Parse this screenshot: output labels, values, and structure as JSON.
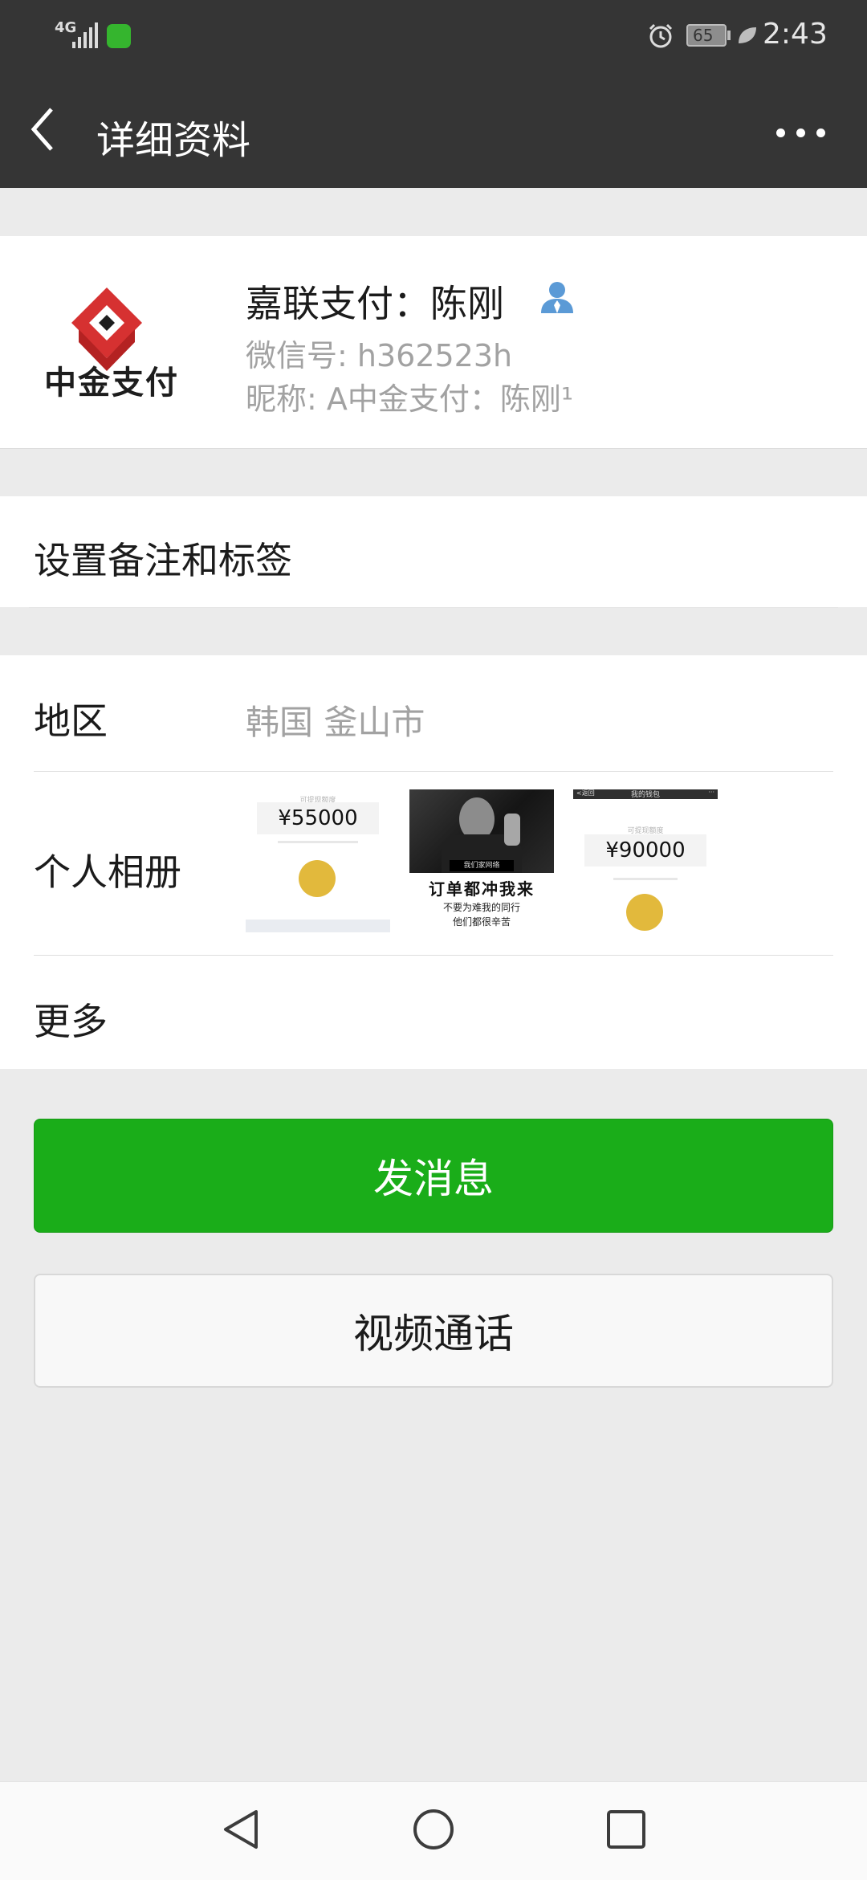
{
  "status_bar": {
    "network": "4G",
    "battery": "65",
    "time": "2:43",
    "icons": [
      "signal-icon",
      "app-notification-icon",
      "alarm-icon",
      "battery-icon",
      "leaf-icon"
    ]
  },
  "header": {
    "title": "详细资料",
    "back_icon": "back-chevron-icon",
    "more_icon": "more-dots-icon"
  },
  "profile": {
    "name": "嘉联支付：陈刚",
    "wechat_id": "微信号: h362523h",
    "nickname": "昵称: A中金支付：陈刚¹",
    "avatar_text": "中金支付",
    "contact_icon": "contact-person-icon"
  },
  "remark": {
    "label": "设置备注和标签"
  },
  "region": {
    "label": "地区",
    "value": "韩国  釜山市"
  },
  "album": {
    "label": "个人相册",
    "photos": [
      {
        "amount": "¥55000",
        "caption": "可提现额度"
      },
      {
        "title": "订单都冲我来",
        "subtitle1": "不要为难我的同行",
        "subtitle2": "他们都很辛苦",
        "badge": "我们家网络"
      },
      {
        "amount": "¥90000",
        "caption": "可提现额度",
        "top_left": "<返回",
        "top_title": "我的钱包",
        "top_right": "···"
      }
    ]
  },
  "more": {
    "label": "更多"
  },
  "actions": {
    "send_message": "发消息",
    "video_call": "视频通话"
  },
  "colors": {
    "header_bg": "#353535",
    "primary_green": "#1aad19",
    "secondary_text": "#a2a2a2",
    "page_bg": "#ebebeb",
    "contact_icon_blue": "#5b9ad6"
  },
  "nav_bar": {
    "buttons": [
      "nav-back-icon",
      "nav-home-icon",
      "nav-recents-icon"
    ]
  }
}
